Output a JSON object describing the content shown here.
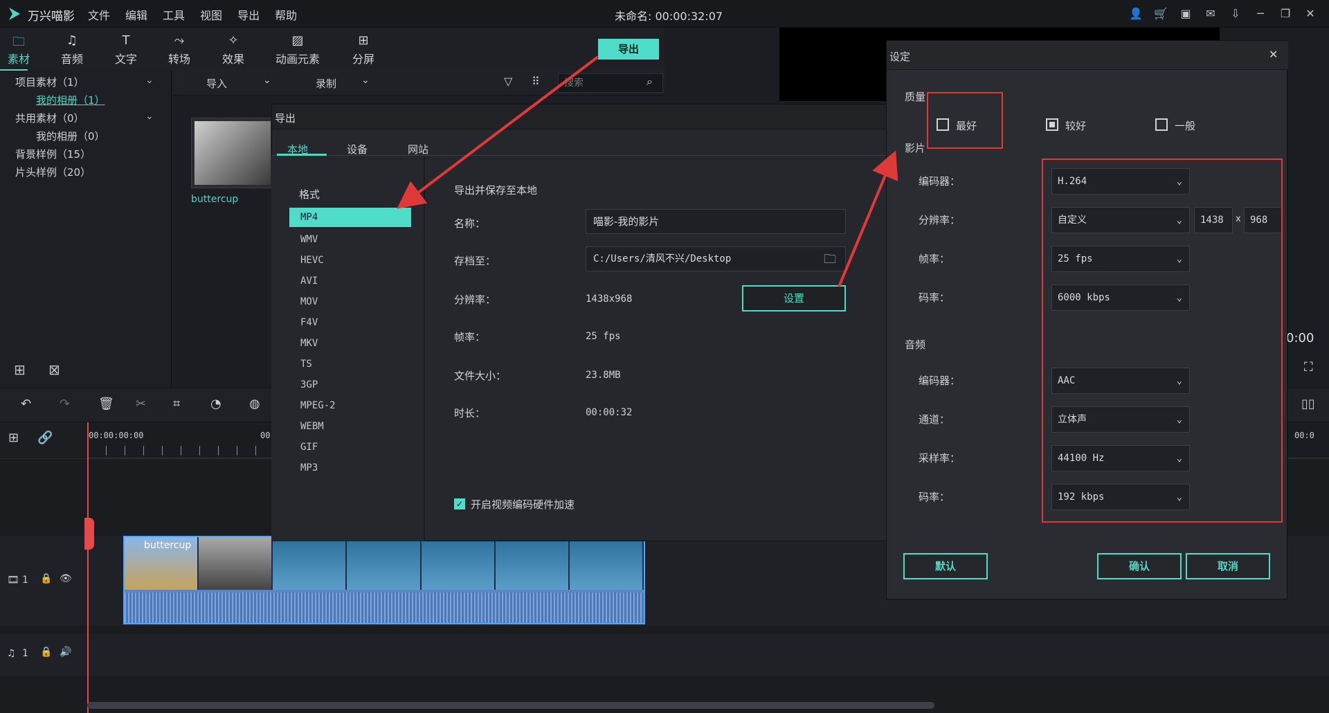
{
  "titlebar": {
    "app": "万兴喵影",
    "menus": [
      "文件",
      "编辑",
      "工具",
      "视图",
      "导出",
      "帮助"
    ],
    "doc": "未命名: 00:00:32:07"
  },
  "toolbar": {
    "tabs": [
      "素材",
      "音频",
      "文字",
      "转场",
      "效果",
      "动画元素",
      "分屏"
    ],
    "export": "导出"
  },
  "left": {
    "items": [
      "项目素材（1）",
      "我的相册（1）",
      "共用素材（0）",
      "我的相册（0）",
      "背景样例（15）",
      "片头样例（20）"
    ]
  },
  "mediabar": {
    "import": "导入",
    "record": "录制",
    "search_placeholder": "搜索"
  },
  "media": {
    "thumb_label": "buttercup"
  },
  "timeline": {
    "ruler_start": "00:00:00:00",
    "ruler_mark": "00",
    "right_time": "00:0",
    "clip_label": "buttercup",
    "track_v": "1",
    "track_a": "1",
    "preview_time": "0:00"
  },
  "export": {
    "title": "导出",
    "tabs": [
      "本地",
      "设备",
      "网站"
    ],
    "format_label": "格式",
    "formats": [
      "MP4",
      "WMV",
      "HEVC",
      "AVI",
      "MOV",
      "F4V",
      "MKV",
      "TS",
      "3GP",
      "MPEG-2",
      "WEBM",
      "GIF",
      "MP3"
    ],
    "section": "导出并保存至本地",
    "name_label": "名称：",
    "name_value": "喵影-我的影片",
    "path_label": "存档至：",
    "path_value": "C:/Users/清风不兴/Desktop",
    "res_label": "分辨率：",
    "res_value": "1438x968",
    "fps_label": "帧率：",
    "fps_value": "25 fps",
    "size_label": "文件大小：",
    "size_value": "23.8MB",
    "dur_label": "时长：",
    "dur_value": "00:00:32",
    "settings_btn": "设置",
    "hw_label": "开启视频编码硬件加速"
  },
  "settings": {
    "title": "设定",
    "quality_label": "质量",
    "quality_opts": [
      "最好",
      "较好",
      "一般"
    ],
    "video_label": "影片",
    "encoder_label": "编码器：",
    "encoder": "H.264",
    "res_label": "分辨率：",
    "res": "自定义",
    "res_w": "1438",
    "res_x": "x",
    "res_h": "968",
    "fps_label": "帧率：",
    "fps": "25 fps",
    "bitrate_label": "码率：",
    "bitrate": "6000 kbps",
    "audio_label": "音频",
    "a_encoder_label": "编码器：",
    "a_encoder": "AAC",
    "channel_label": "通道：",
    "channel": "立体声",
    "sample_label": "采样率：",
    "sample": "44100 Hz",
    "a_bitrate_label": "码率：",
    "a_bitrate": "192 kbps",
    "default_btn": "默认",
    "ok_btn": "确认",
    "cancel_btn": "取消"
  },
  "colors": {
    "accent": "#4fdcc9",
    "annotation": "#e0393a"
  }
}
